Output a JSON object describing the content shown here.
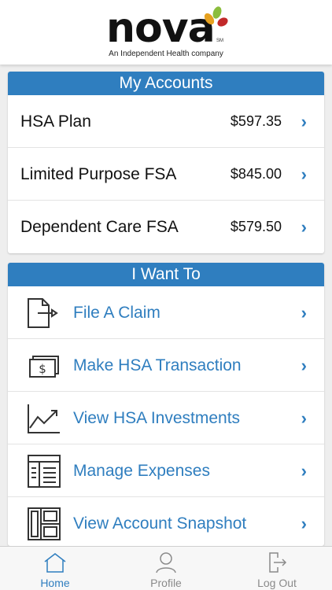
{
  "header": {
    "brand": "nova",
    "service_mark": "SM",
    "tagline": "An Independent Health company",
    "colors": {
      "leaf1": "#e6a11f",
      "leaf2": "#8bbd3c",
      "leaf3": "#c2292a"
    }
  },
  "accounts": {
    "title": "My Accounts",
    "items": [
      {
        "name": "HSA Plan",
        "amount": "$597.35"
      },
      {
        "name": "Limited Purpose FSA",
        "amount": "$845.00"
      },
      {
        "name": "Dependent Care FSA",
        "amount": "$579.50"
      }
    ]
  },
  "actions": {
    "title": "I Want To",
    "items": [
      {
        "label": "File A Claim",
        "icon": "file-claim-icon"
      },
      {
        "label": "Make HSA Transaction",
        "icon": "money-icon"
      },
      {
        "label": "View HSA Investments",
        "icon": "chart-line-icon"
      },
      {
        "label": "Manage Expenses",
        "icon": "expenses-list-icon"
      },
      {
        "label": "View Account Snapshot",
        "icon": "snapshot-grid-icon"
      }
    ]
  },
  "tabbar": {
    "home": "Home",
    "profile": "Profile",
    "logout": "Log Out",
    "active": "home"
  },
  "colors": {
    "accent": "#2f7ebf",
    "inactive": "#8a8a8a"
  }
}
